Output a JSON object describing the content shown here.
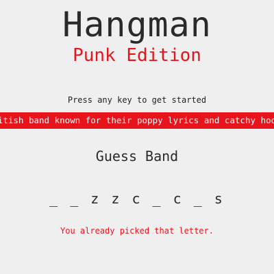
{
  "header": {
    "title": "Hangman",
    "subtitle": "Punk Edition"
  },
  "prompt": "Press any key to get started",
  "hint": "British band known for their poppy lyrics and catchy hooks",
  "category": "Guess Band",
  "word_display": "_ _ z z c _ c _ s",
  "message": "You already picked that letter.",
  "colors": {
    "accent": "#e8141c",
    "background": "#efefef",
    "text": "#2a2a2a"
  }
}
